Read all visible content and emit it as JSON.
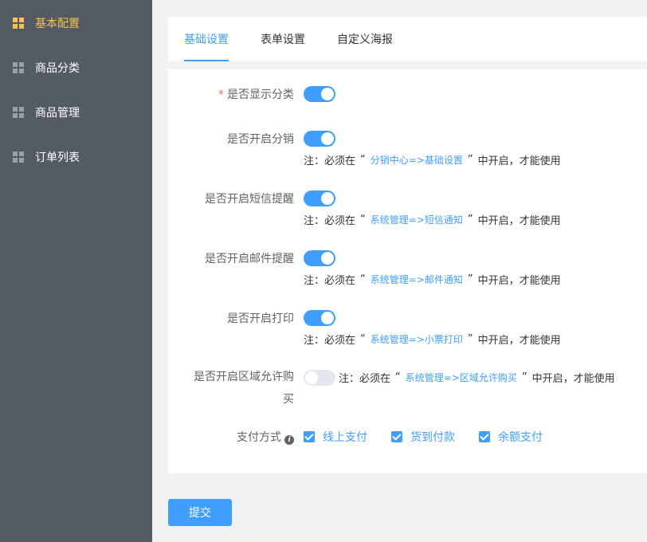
{
  "sidebar": {
    "items": [
      {
        "label": "基本配置",
        "active": true
      },
      {
        "label": "商品分类",
        "active": false
      },
      {
        "label": "商品管理",
        "active": false
      },
      {
        "label": "订单列表",
        "active": false
      }
    ]
  },
  "tabs": [
    {
      "label": "基础设置",
      "active": true
    },
    {
      "label": "表单设置",
      "active": false
    },
    {
      "label": "自定义海报",
      "active": false
    }
  ],
  "form": {
    "show_category": {
      "required_mark": "*",
      "label": "是否显示分类",
      "enabled": true
    },
    "distribution": {
      "label": "是否开启分销",
      "enabled": true,
      "note_prefix": "注：必须在",
      "open_quote": "“",
      "link": "分销中心=>基础设置",
      "close_quote": "”",
      "note_suffix": "中开启，才能使用"
    },
    "sms": {
      "label": "是否开启短信提醒",
      "enabled": true,
      "note_prefix": "注：必须在",
      "open_quote": "“",
      "link": "系统管理=>短信通知",
      "close_quote": "”",
      "note_suffix": "中开启，才能使用"
    },
    "email": {
      "label": "是否开启邮件提醒",
      "enabled": true,
      "note_prefix": "注：必须在",
      "open_quote": "“",
      "link": "系统管理=>邮件通知",
      "close_quote": "”",
      "note_suffix": "中开启，才能使用"
    },
    "print": {
      "label": "是否开启打印",
      "enabled": true,
      "note_prefix": "注：必须在",
      "open_quote": "“",
      "link": "系统管理=>小票打印",
      "close_quote": "”",
      "note_suffix": "中开启，才能使用"
    },
    "region": {
      "label_line1": "是否开启区域允许购",
      "label_line2": "买",
      "enabled": false,
      "note_prefix": "注：必须在",
      "open_quote": "“",
      "link": "系统管理=>区域允许购买",
      "close_quote": "”",
      "note_suffix": "中开启，才能使用"
    },
    "payment": {
      "label": "支付方式",
      "info_icon": "i",
      "options": [
        {
          "label": "线上支付",
          "checked": true
        },
        {
          "label": "货到付款",
          "checked": true
        },
        {
          "label": "余额支付",
          "checked": true
        }
      ]
    }
  },
  "submit_label": "提交",
  "colors": {
    "accent": "#409eff",
    "sidebar_bg": "#545b65",
    "sidebar_active": "#f7c04a",
    "required": "#f56c6c"
  }
}
